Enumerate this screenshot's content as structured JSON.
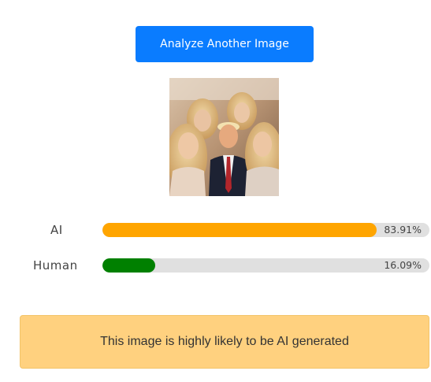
{
  "actions": {
    "analyze_label": "Analyze Another Image"
  },
  "image": {
    "alt": "Uploaded photo being analyzed"
  },
  "results": [
    {
      "label": "AI",
      "percent_text": "83.91%",
      "value": 83.91,
      "color": "#ffa500"
    },
    {
      "label": "Human",
      "percent_text": "16.09%",
      "value": 16.09,
      "color": "#008000"
    }
  ],
  "colors": {
    "button": "#0a7cff",
    "track": "#e0e0e0",
    "verdict_bg": "#ffd17f"
  },
  "verdict": {
    "text": "This image is highly likely to be AI generated"
  }
}
